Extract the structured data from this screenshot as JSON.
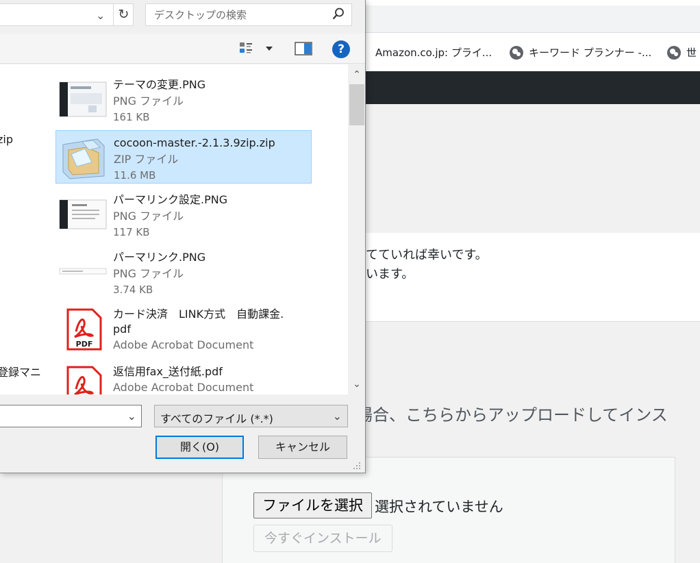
{
  "browser": {
    "bookmarks": [
      {
        "label": "Amazon.co.jp: プライ..."
      },
      {
        "label": "キーワード プランナー -...",
        "icon": "globe-icon"
      },
      {
        "label": "世",
        "icon": "globe-icon"
      }
    ]
  },
  "wp": {
    "notice_line1": "立てていれば幸いです。",
    "notice_line2": "ざいます。",
    "upload_help": "場合、こちらからアップロードしてインス",
    "file_button": "ファイルを選択",
    "file_status": "選択されていません",
    "install_button": "今すぐインストール"
  },
  "dialog": {
    "search_placeholder": "デスクトップの検索",
    "help_label": "?",
    "stray_left_1": "zip",
    "stray_left_2": "登録マニ",
    "files": [
      {
        "name": "テーマの変更.PNG",
        "type": "PNG ファイル",
        "size": "161 KB",
        "icon": "png-thumbnail-icon"
      },
      {
        "name": "cocoon-master.-2.1.3.9zip.zip",
        "type": "ZIP ファイル",
        "size": "11.6 MB",
        "icon": "zip-folder-icon",
        "selected": true
      },
      {
        "name": "パーマリンク設定.PNG",
        "type": "PNG ファイル",
        "size": "117 KB",
        "icon": "png-thumbnail-icon"
      },
      {
        "name": "パーマリンク.PNG",
        "type": "PNG ファイル",
        "size": "3.74 KB",
        "icon": "png-thumbnail-icon"
      },
      {
        "name_line1": "カード決済　LINK方式　自動課金.",
        "name_line2": "pdf",
        "type": "Adobe Acrobat Document",
        "icon": "pdf-icon"
      },
      {
        "name": "返信用fax_送付紙.pdf",
        "type": "Adobe Acrobat Document",
        "icon": "pdf-icon"
      }
    ],
    "filter_value": "すべてのファイル (*.*)",
    "open_button": "開く(O)",
    "cancel_button": "キャンセル"
  },
  "colors": {
    "selection": "#cce8ff",
    "accent": "#0078d7",
    "pdf_red": "#e0201b",
    "admin_bar": "#23282d"
  }
}
